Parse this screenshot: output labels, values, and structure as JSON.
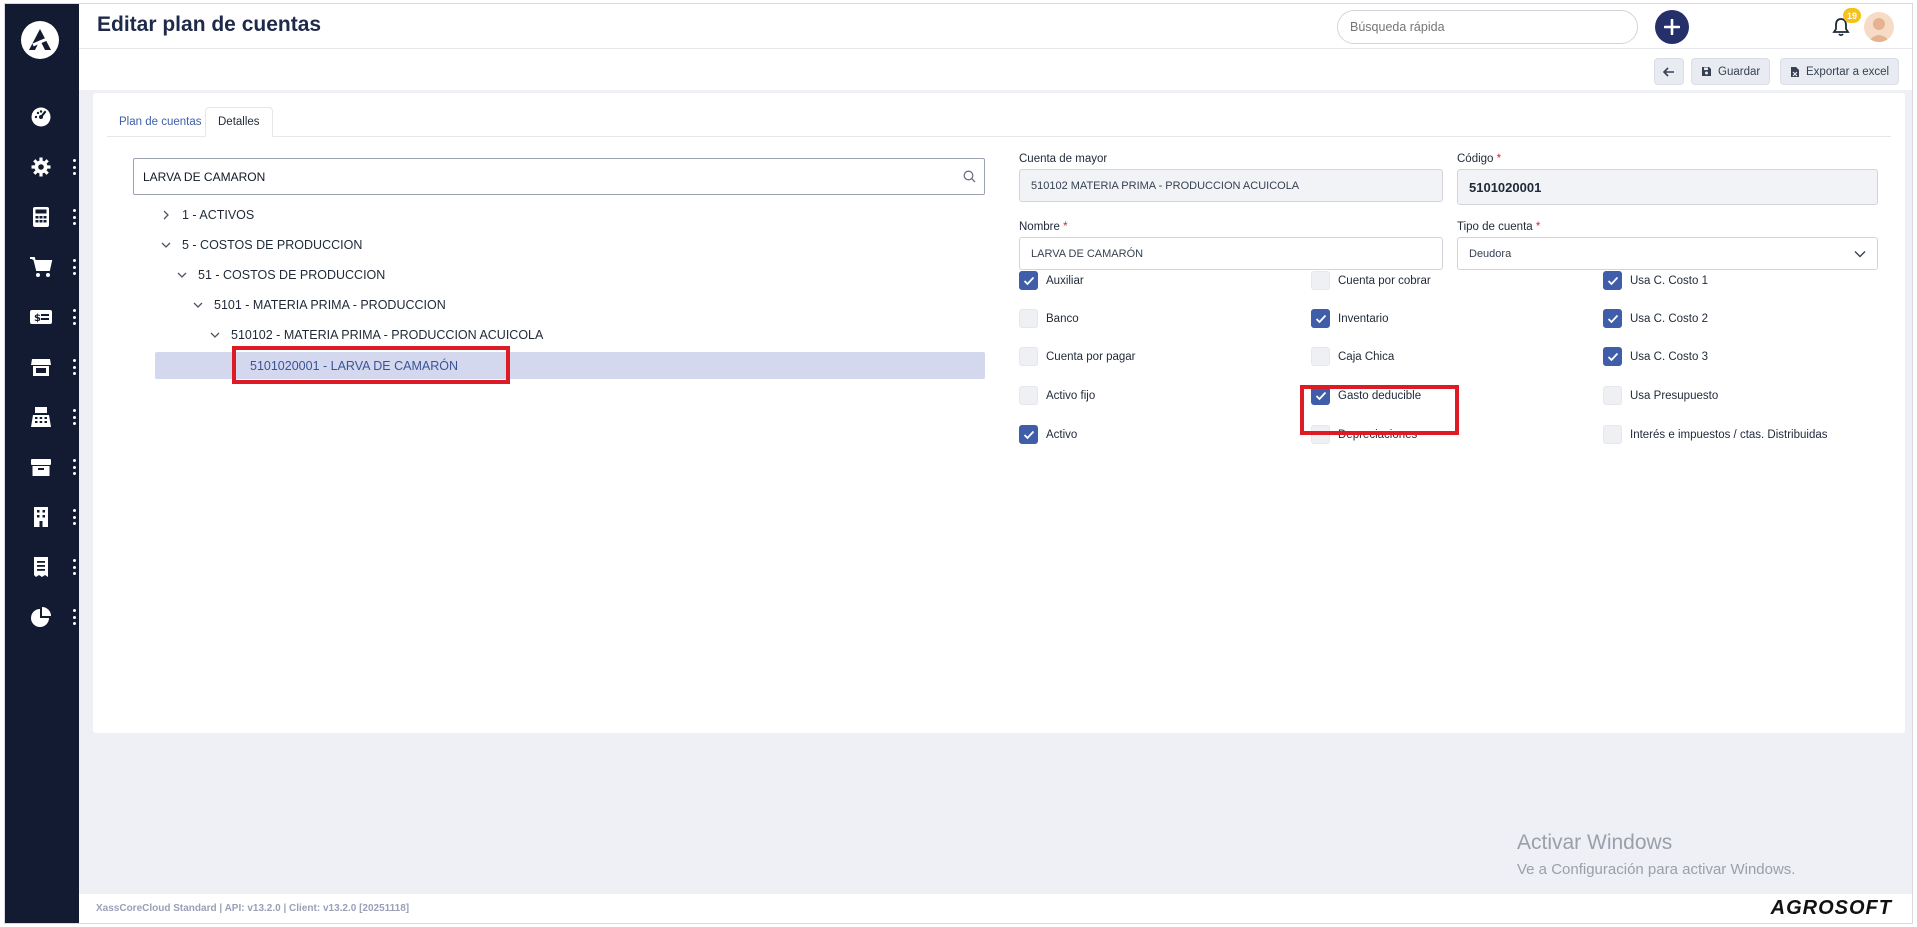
{
  "app": {
    "title": "Editar plan de cuentas",
    "footer_version": "XassCoreCloud Standard | API: v13.2.0 | Client: v13.2.0 [20251118]",
    "brand": "AGROSOFT",
    "accent_color": "#25306b",
    "sidebar_color": "#131b33"
  },
  "sidebar": {
    "items": [
      {
        "icon": "dashboard-icon"
      },
      {
        "icon": "gear-icon"
      },
      {
        "icon": "calculator-icon"
      },
      {
        "icon": "cart-icon"
      },
      {
        "icon": "money-icon"
      },
      {
        "icon": "store-icon"
      },
      {
        "icon": "cash-register-icon"
      },
      {
        "icon": "box-icon"
      },
      {
        "icon": "building-icon"
      },
      {
        "icon": "receipt-icon"
      },
      {
        "icon": "pie-chart-icon"
      }
    ]
  },
  "header": {
    "search_placeholder": "Búsqueda rápida",
    "notification_count": "19"
  },
  "toolbar": {
    "save_label": "Guardar",
    "export_label": "Exportar a excel"
  },
  "tabs": [
    {
      "label": "Plan de cuentas"
    },
    {
      "label": "Detalles"
    }
  ],
  "tree": {
    "search_value": "LARVA DE CAMARON",
    "nodes": [
      {
        "label": "1 - ACTIVOS",
        "expanded": false
      },
      {
        "label": "5 - COSTOS DE PRODUCCION",
        "expanded": true
      },
      {
        "label": "51 - COSTOS DE PRODUCCION",
        "expanded": true
      },
      {
        "label": "5101 - MATERIA PRIMA - PRODUCCION",
        "expanded": true
      },
      {
        "label": "510102 - MATERIA PRIMA - PRODUCCION ACUICOLA",
        "expanded": true
      },
      {
        "label": "5101020001 - LARVA DE CAMARÓN",
        "selected": true
      }
    ]
  },
  "form": {
    "cuenta_mayor_label": "Cuenta de mayor",
    "cuenta_mayor_value": "510102 MATERIA PRIMA - PRODUCCION ACUICOLA",
    "codigo_label": "Código",
    "codigo_value": "5101020001",
    "nombre_label": "Nombre",
    "nombre_value": "LARVA DE CAMARÓN",
    "tipo_label": "Tipo de cuenta",
    "tipo_value": "Deudora",
    "required_mark": "*"
  },
  "checkboxes": [
    {
      "label": "Auxiliar",
      "checked": true
    },
    {
      "label": "Cuenta por cobrar",
      "checked": false
    },
    {
      "label": "Usa C. Costo 1",
      "checked": true
    },
    {
      "label": "Banco",
      "checked": false
    },
    {
      "label": "Inventario",
      "checked": true
    },
    {
      "label": "Usa C. Costo 2",
      "checked": true
    },
    {
      "label": "Cuenta por pagar",
      "checked": false
    },
    {
      "label": "Caja Chica",
      "checked": false
    },
    {
      "label": "Usa C. Costo 3",
      "checked": true
    },
    {
      "label": "Activo fijo",
      "checked": false
    },
    {
      "label": "Gasto deducible",
      "checked": true
    },
    {
      "label": "Usa Presupuesto",
      "checked": false
    },
    {
      "label": "Activo",
      "checked": true
    },
    {
      "label": "Depreciaciones",
      "checked": false
    },
    {
      "label": "Interés e impuestos / ctas. Distribuidas",
      "checked": false
    }
  ],
  "watermark": {
    "line1": "Activar Windows",
    "line2": "Ve a Configuración para activar Windows."
  }
}
